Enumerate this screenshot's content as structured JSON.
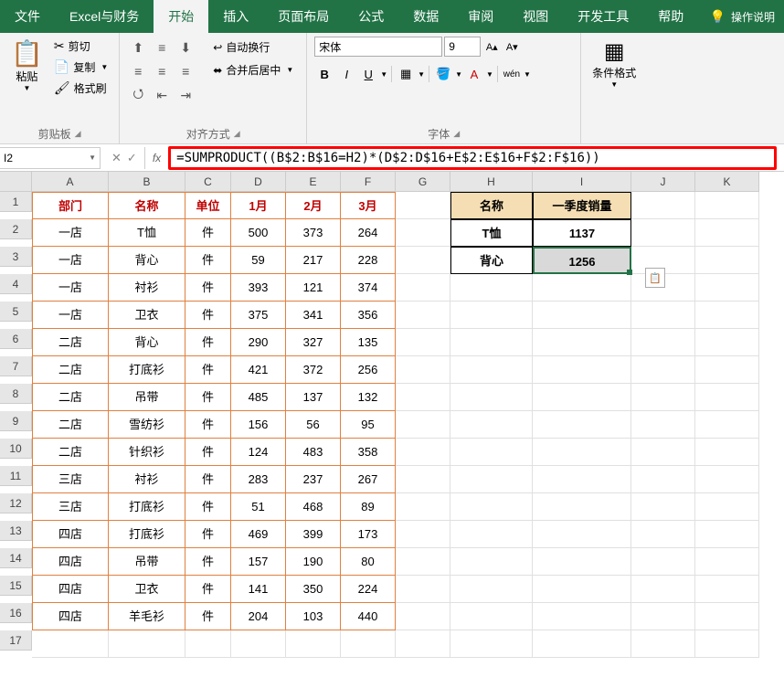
{
  "tabs": {
    "file": "文件",
    "brand": "Excel与财务",
    "home": "开始",
    "insert": "插入",
    "layout": "页面布局",
    "formulas": "公式",
    "data": "数据",
    "review": "审阅",
    "view": "视图",
    "dev": "开发工具",
    "help": "帮助",
    "tell": "操作说明"
  },
  "clipboard": {
    "paste": "粘贴",
    "cut": "剪切",
    "copy": "复制",
    "painter": "格式刷",
    "title": "剪贴板"
  },
  "align": {
    "wrap": "自动换行",
    "merge": "合并后居中",
    "title": "对齐方式"
  },
  "font": {
    "name": "宋体",
    "size": "9",
    "title": "字体",
    "bold": "B",
    "italic": "I",
    "underline": "U",
    "wen": "wén"
  },
  "cond": {
    "label": "条件格式",
    "title": ""
  },
  "formula": {
    "cell": "I2",
    "text": "=SUMPRODUCT((B$2:B$16=H2)*(D$2:D$16+E$2:E$16+F$2:F$16))"
  },
  "cols": [
    "A",
    "B",
    "C",
    "D",
    "E",
    "F",
    "G",
    "H",
    "I",
    "J",
    "K"
  ],
  "mainHeaders": {
    "dept": "部门",
    "name": "名称",
    "unit": "单位",
    "jan": "1月",
    "feb": "2月",
    "mar": "3月"
  },
  "sumHeaders": {
    "name": "名称",
    "qty": "一季度销量"
  },
  "sumData": [
    {
      "name": "T恤",
      "val": "1137"
    },
    {
      "name": "背心",
      "val": "1256"
    }
  ],
  "rows": [
    {
      "A": "一店",
      "B": "T恤",
      "C": "件",
      "D": "500",
      "E": "373",
      "F": "264"
    },
    {
      "A": "一店",
      "B": "背心",
      "C": "件",
      "D": "59",
      "E": "217",
      "F": "228"
    },
    {
      "A": "一店",
      "B": "衬衫",
      "C": "件",
      "D": "393",
      "E": "121",
      "F": "374"
    },
    {
      "A": "一店",
      "B": "卫衣",
      "C": "件",
      "D": "375",
      "E": "341",
      "F": "356"
    },
    {
      "A": "二店",
      "B": "背心",
      "C": "件",
      "D": "290",
      "E": "327",
      "F": "135"
    },
    {
      "A": "二店",
      "B": "打底衫",
      "C": "件",
      "D": "421",
      "E": "372",
      "F": "256"
    },
    {
      "A": "二店",
      "B": "吊带",
      "C": "件",
      "D": "485",
      "E": "137",
      "F": "132"
    },
    {
      "A": "二店",
      "B": "雪纺衫",
      "C": "件",
      "D": "156",
      "E": "56",
      "F": "95"
    },
    {
      "A": "二店",
      "B": "针织衫",
      "C": "件",
      "D": "124",
      "E": "483",
      "F": "358"
    },
    {
      "A": "三店",
      "B": "衬衫",
      "C": "件",
      "D": "283",
      "E": "237",
      "F": "267"
    },
    {
      "A": "三店",
      "B": "打底衫",
      "C": "件",
      "D": "51",
      "E": "468",
      "F": "89"
    },
    {
      "A": "四店",
      "B": "打底衫",
      "C": "件",
      "D": "469",
      "E": "399",
      "F": "173"
    },
    {
      "A": "四店",
      "B": "吊带",
      "C": "件",
      "D": "157",
      "E": "190",
      "F": "80"
    },
    {
      "A": "四店",
      "B": "卫衣",
      "C": "件",
      "D": "141",
      "E": "350",
      "F": "224"
    },
    {
      "A": "四店",
      "B": "羊毛衫",
      "C": "件",
      "D": "204",
      "E": "103",
      "F": "440"
    }
  ]
}
